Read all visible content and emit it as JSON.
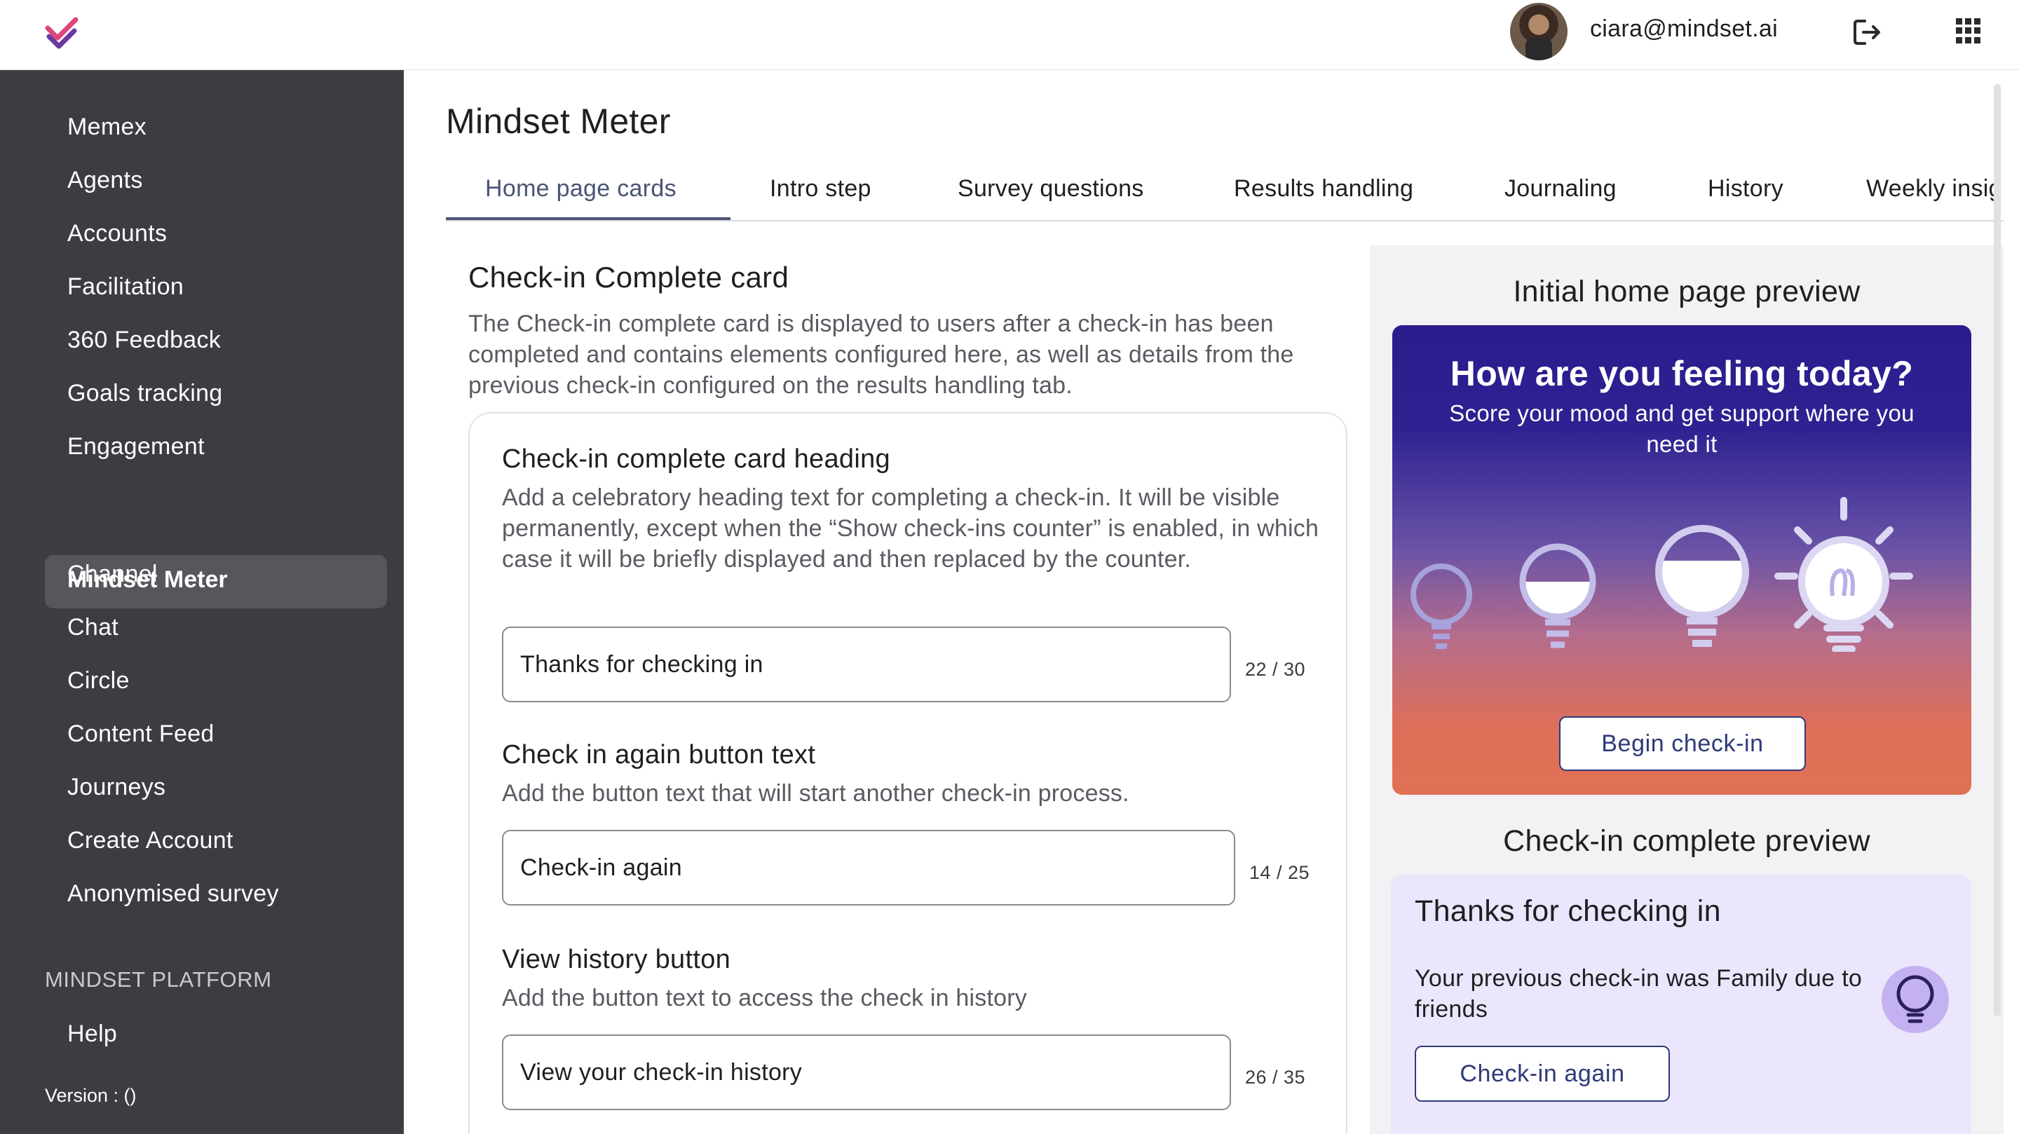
{
  "header": {
    "user_email": "ciara@mindset.ai"
  },
  "sidebar": {
    "items": [
      {
        "label": "Memex"
      },
      {
        "label": "Agents"
      },
      {
        "label": "Accounts"
      },
      {
        "label": "Facilitation"
      },
      {
        "label": "360 Feedback"
      },
      {
        "label": "Goals tracking"
      },
      {
        "label": "Engagement"
      },
      {
        "label": "Mindset Meter",
        "active": true
      },
      {
        "label": "Channel"
      },
      {
        "label": "Chat"
      },
      {
        "label": "Circle"
      },
      {
        "label": "Content Feed"
      },
      {
        "label": "Journeys"
      },
      {
        "label": "Create Account"
      },
      {
        "label": "Anonymised survey"
      }
    ],
    "section_label": "MINDSET PLATFORM",
    "help_label": "Help",
    "version_text": "Version :  ()"
  },
  "page": {
    "title": "Mindset Meter",
    "tabs": [
      {
        "label": "Home page cards",
        "active": true
      },
      {
        "label": "Intro step"
      },
      {
        "label": "Survey questions"
      },
      {
        "label": "Results handling"
      },
      {
        "label": "Journaling"
      },
      {
        "label": "History"
      },
      {
        "label": "Weekly insig"
      }
    ]
  },
  "section": {
    "title": "Check-in Complete card",
    "description": "The Check-in complete card is displayed to users after a check-in has been completed and contains elements configured here, as well as details from the previous check-in configured on the results handling tab."
  },
  "fields": [
    {
      "title": "Check-in complete card heading",
      "description": "Add a celebratory heading text for completing a check-in. It will be visible permanently, except when the “Show check-ins counter” is enabled, in which case it will be briefly displayed and then replaced by the counter.",
      "value": "Thanks for checking in",
      "counter": "22 / 30"
    },
    {
      "title": "Check in again button text",
      "description": "Add the button text that will start another check-in process.",
      "value": "Check-in again",
      "counter": "14 / 25"
    },
    {
      "title": "View history button",
      "description": "Add the button text to access the check in history",
      "value": "View your check-in history",
      "counter": "26 / 35"
    }
  ],
  "preview": {
    "home_heading": "Initial home page preview",
    "home_card": {
      "title": "How are you feeling today?",
      "subtitle": "Score your mood and get support where you need it",
      "button": "Begin check-in"
    },
    "complete_heading": "Check-in complete preview",
    "complete_card": {
      "title": "Thanks for checking in",
      "text": "Your previous check-in was Family due to friends",
      "button": "Check-in again"
    }
  },
  "colors": {
    "sidebar_bg": "#3c3c42",
    "accent": "#4a5474",
    "button_border": "#2e3a78",
    "complete_card_bg": "#ebe6fb"
  }
}
